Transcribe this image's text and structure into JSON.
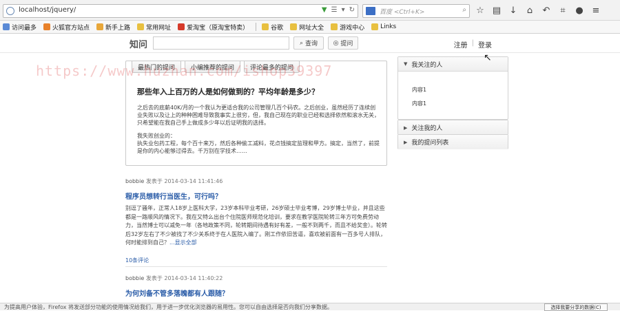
{
  "browser": {
    "url": "localhost/jquery/",
    "search_placeholder": "百度 <Ctrl+K>",
    "bookmarks": [
      "访问最多",
      "火狐官方站点",
      "新手上路",
      "常用网址",
      "爱淘宝（原淘宝特卖）",
      "谷歌",
      "网址大全",
      "游戏中心",
      "Links"
    ]
  },
  "watermark": "https://www.huzhan.com/ishop39397",
  "nav": {
    "logo": "知问",
    "query_btn": "查询",
    "ask_btn": "提问",
    "register": "注册",
    "divider": "|",
    "login": "登录"
  },
  "featured": {
    "tabs": [
      "最热门的提问",
      "小编推荐的提问",
      "评论最多的提问"
    ],
    "title": "那些年入上百万的人是如何做到的？平均年龄是多少？",
    "para1": "之后去的底薪40K/月的一个我认为更适合我的公司管理几百个码农。之后创业，虽然经历了连续创业失败以及让上的种种困难导致我事实上很穷，但，我自己现在的职业已经和选择依然和滚水无关，只希望能在我自己手上做成多少年以后证明我的选择。",
    "para2": "我失败创业的：",
    "para3": "执失业包药工程，每个百十来万，然后各种偷工减料，花点钱搞定监理和甲方。搞定，当然了，前提是你的内心能够过得去。千万别在学技术……"
  },
  "feed": [
    {
      "author": "bobbie",
      "verb": "发表于",
      "time": "2014-03-14 11:41:46",
      "title": "程序员想转行当医生，可行吗？",
      "body": "别逗了骚年，正常人18岁上医科大学，23岁本科毕业考研，26岁硕士毕业考博，29岁博士毕业，并且这些都是一路顺风的情况下。我在又特么出台个住院医师规范化培训，要求在教学医院轮转三年方可免费劳动力，当然博士可以减免一年（各地政策不同，轮转期间待遇有好有差，一般不到两千，而且不给奖金）。轮转后32岁左右了不少被找了不少关系终于在人医院入编了。刚工作依旧苦逼，喜欢被前面有一百多号人排队，何时能排到自己？",
      "more": "...显示全部",
      "comments": "10条评论"
    },
    {
      "author": "bobbie",
      "verb": "发表于",
      "time": "2014-03-14 11:40:22",
      "title": "为何刘备不管多落魄都有人跟随？"
    }
  ],
  "sidebar": [
    {
      "title": "我关注的人",
      "expanded": true,
      "items": [
        "内容1",
        "内容1"
      ]
    },
    {
      "title": "关注我的人",
      "expanded": false,
      "items": []
    },
    {
      "title": "我的提问列表",
      "expanded": false,
      "items": []
    }
  ],
  "status": {
    "text": "为提高用户体验，Firefox 将发送部分功能的使用情况给我们，用于进一步优化浏览器的易用性。您可以自由选择是否向我们分享数据。",
    "button": "选择我要分享的数据(C)"
  },
  "colors": {
    "link": "#2a5ca8",
    "watermark": "#dc3c3c"
  }
}
